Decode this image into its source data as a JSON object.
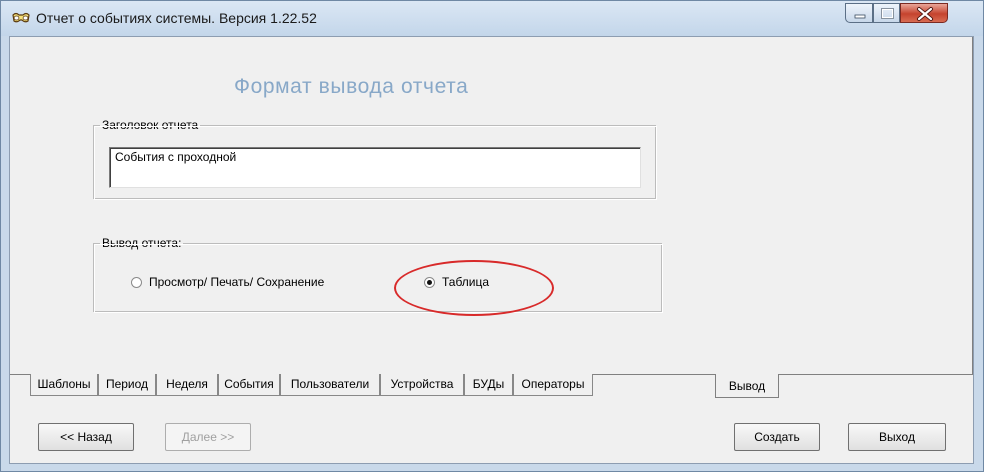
{
  "window": {
    "title": "Отчет о событиях системы.  Версия 1.22.52"
  },
  "icons": {
    "app": "glasses-icon",
    "minimize": "minimize-icon",
    "maximize": "maximize-icon",
    "close": "close-icon"
  },
  "colors": {
    "heading": "#88a8c8",
    "highlight_ellipse": "#d82a2a",
    "close_button": "#c5432e"
  },
  "main": {
    "heading": "Формат вывода отчета",
    "report_title_group": {
      "legend": "Заголовок отчета",
      "value": "События с проходной"
    },
    "output_group": {
      "legend": "Вывод отчета:",
      "options": [
        {
          "label": "Просмотр/ Печать/ Сохранение",
          "selected": false
        },
        {
          "label": "Таблица",
          "selected": true
        }
      ]
    }
  },
  "tabs": [
    {
      "label": "Шаблоны",
      "active": false
    },
    {
      "label": "Период",
      "active": false
    },
    {
      "label": "Неделя",
      "active": false
    },
    {
      "label": "События",
      "active": false
    },
    {
      "label": "Пользователи",
      "active": false
    },
    {
      "label": "Устройства",
      "active": false
    },
    {
      "label": "БУДы",
      "active": false
    },
    {
      "label": "Операторы",
      "active": false
    },
    {
      "label": "Вывод",
      "active": true
    }
  ],
  "buttons": {
    "back": "<< Назад",
    "next": "Далее >>",
    "create": "Создать",
    "exit": "Выход"
  }
}
